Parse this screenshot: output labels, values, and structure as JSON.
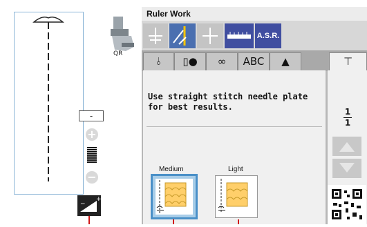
{
  "left": {
    "foot_label": "QR",
    "minus_label": "-",
    "plus_symbol": "+",
    "minus_symbol": "−"
  },
  "header": {
    "title": "Ruler Work"
  },
  "toolbar": {
    "asr_label": "A.S.R."
  },
  "tabs": [
    {
      "label": "⫰",
      "icon": "stitch-utility-icon"
    },
    {
      "label": "▯●",
      "icon": "buttonhole-icon"
    },
    {
      "label": "∞",
      "icon": "decorative-icon"
    },
    {
      "label": "ABC",
      "icon": "letters-icon"
    },
    {
      "label": "▲",
      "icon": "quilt-icon"
    },
    {
      "label": "⊤",
      "icon": "garment-icon"
    }
  ],
  "message": "Use straight stitch needle plate\nfor best results.",
  "page": {
    "current": "1",
    "total": "1"
  },
  "options": [
    {
      "label": "Medium",
      "selected": true
    },
    {
      "label": "Light",
      "selected": false
    }
  ],
  "colors": {
    "accent": "#404ea0",
    "tool_active": "#4a6fb0",
    "selected_border": "#4a90c8",
    "scale_fill": "#ffcf6a",
    "red": "#d01818"
  }
}
